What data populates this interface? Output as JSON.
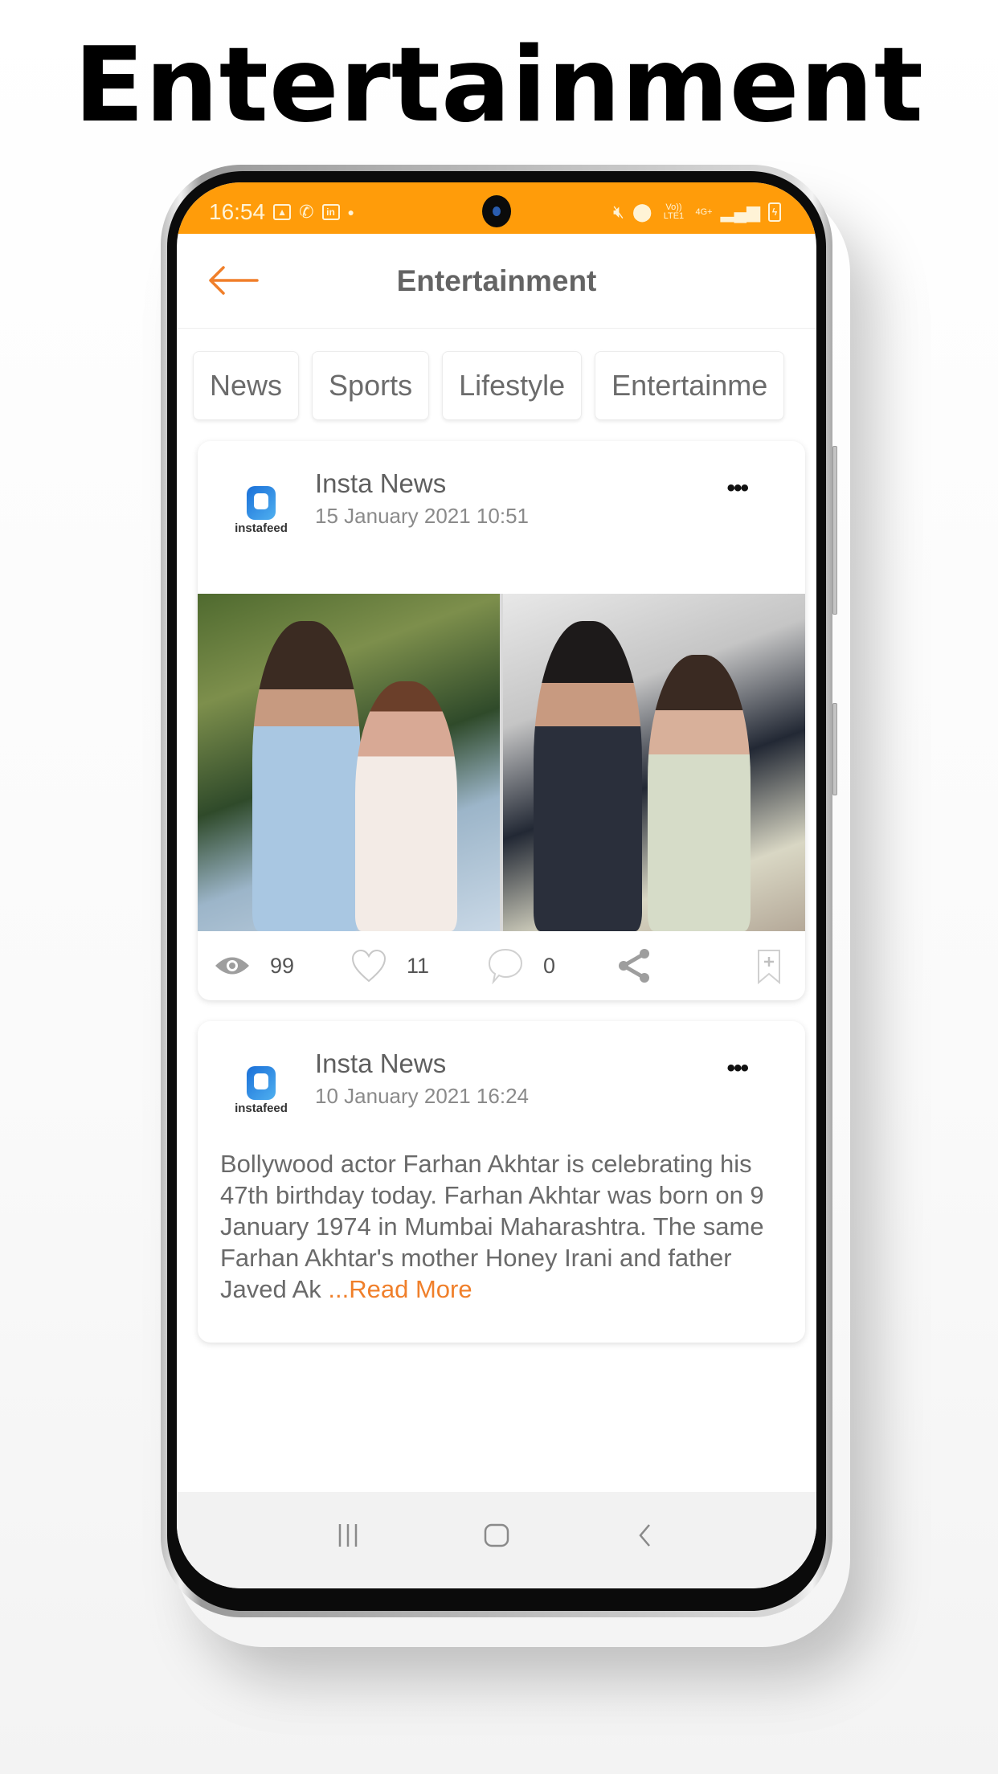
{
  "promo": {
    "title": "Entertainment"
  },
  "status_bar": {
    "time": "16:54",
    "left_icons": [
      "gallery-icon",
      "whatsapp-icon",
      "linkedin-icon",
      "dot-icon"
    ],
    "right_icons": [
      "mute-vibrate-icon",
      "location-icon",
      "volte-icon",
      "4g-icon",
      "signal-icon",
      "battery-charging-icon"
    ],
    "volte_label": "Vo)) LTE1",
    "network_label": "4G+"
  },
  "app_bar": {
    "title": "Entertainment",
    "back_icon": "arrow-left-icon",
    "accent_color": "#f07f2a"
  },
  "tabs": [
    {
      "label": "News"
    },
    {
      "label": "Sports"
    },
    {
      "label": "Lifestyle"
    },
    {
      "label": "Entertainme"
    }
  ],
  "posts": [
    {
      "logo_text": "instafeed",
      "source": "Insta News",
      "date": "15 January 2021 10:51",
      "more_icon": "more-horizontal-icon",
      "image": "photo-collage",
      "stats": {
        "views": "99",
        "likes": "11",
        "comments": "0"
      }
    },
    {
      "logo_text": "instafeed",
      "source": "Insta News",
      "date": "10 January 2021 16:24",
      "more_icon": "more-horizontal-icon",
      "body": "Bollywood actor Farhan Akhtar is celebrating his 47th birthday today. Farhan Akhtar was born on 9 January 1974 in Mumbai Maharashtra. The same Farhan Akhtar's mother Honey Irani and father Javed Ak ",
      "read_more": "...Read More",
      "image": "photo-partial"
    }
  ],
  "nav_bar": {
    "items": [
      "recents-icon",
      "home-icon",
      "back-icon"
    ]
  },
  "colors": {
    "status_bar": "#ff9c0a",
    "accent": "#f07f2a",
    "text_primary": "#646464"
  }
}
